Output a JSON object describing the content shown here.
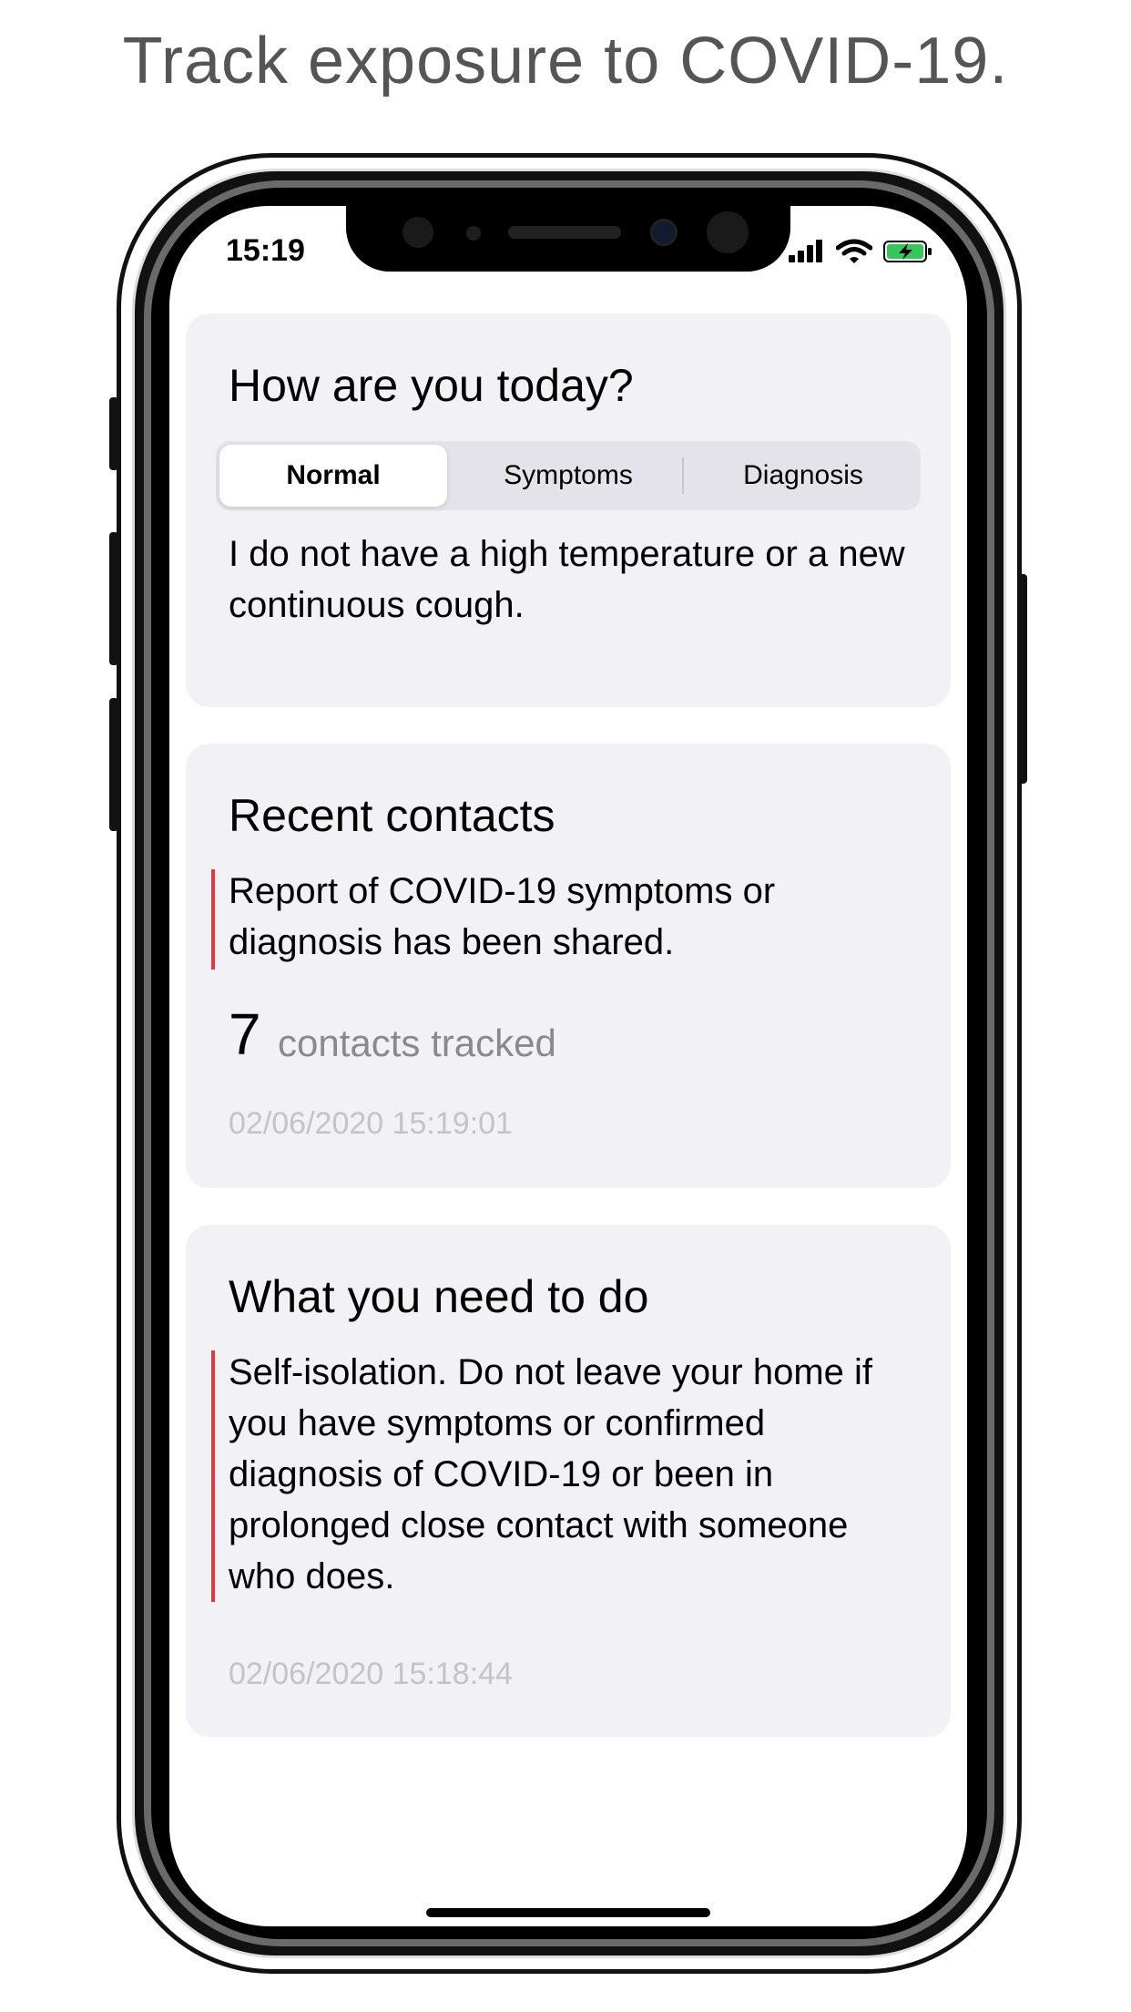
{
  "headline": "Track exposure to COVID-19.",
  "status_bar": {
    "time": "15:19"
  },
  "health_card": {
    "title": "How are you today?",
    "segments": [
      {
        "label": "Normal",
        "selected": true
      },
      {
        "label": "Symptoms",
        "selected": false
      },
      {
        "label": "Diagnosis",
        "selected": false
      }
    ],
    "description": "I do not have a high temperature or a new continuous cough."
  },
  "contacts_card": {
    "title": "Recent contacts",
    "alert": "Report of COVID-19 symptoms or diagnosis has been shared.",
    "count": "7",
    "count_label": "contacts tracked",
    "timestamp": "02/06/2020 15:19:01"
  },
  "advice_card": {
    "title": "What you need to do",
    "advice": "Self-isolation. Do not leave your home if you have symptoms or confirmed diagnosis of COVID-19 or been in prolonged close contact with someone who does.",
    "timestamp": "02/06/2020 15:18:44"
  },
  "colors": {
    "accent_red": "#e0393e",
    "card_background": "#f2f1f6",
    "battery_green": "#34c759"
  },
  "icons": [
    "signal-icon",
    "wifi-icon",
    "battery-charging-icon"
  ]
}
